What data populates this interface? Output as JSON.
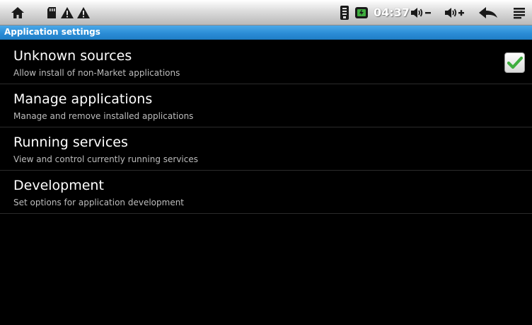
{
  "status_bar": {
    "time": "04:37",
    "icons": [
      "home-icon",
      "sd-card-icon",
      "warning-icon",
      "warning-icon",
      "wifi-icon",
      "battery-icon",
      "volume-down-icon",
      "volume-up-icon",
      "back-icon",
      "menu-icon"
    ]
  },
  "title_bar": {
    "title": "Application settings",
    "color": "#2b8dd6"
  },
  "settings": [
    {
      "title": "Unknown sources",
      "summary": "Allow install of non-Market applications",
      "checked": true
    },
    {
      "title": "Manage applications",
      "summary": "Manage and remove installed applications"
    },
    {
      "title": "Running services",
      "summary": "View and control currently running services"
    },
    {
      "title": "Development",
      "summary": "Set options for application development"
    }
  ]
}
